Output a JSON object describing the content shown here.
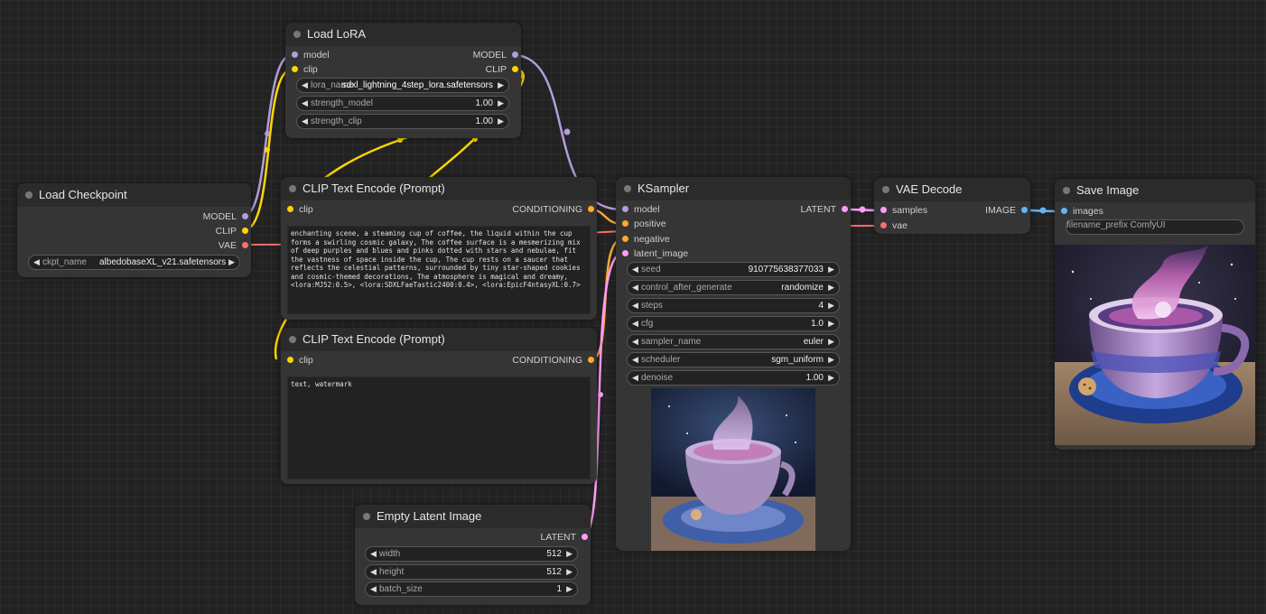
{
  "colors": {
    "model": "#b39ddb",
    "clip": "#ffd500",
    "vae": "#ff6e6e",
    "conditioning": "#ffa931",
    "latent": "#ff9cf9",
    "image": "#64b5f6"
  },
  "load_checkpoint": {
    "title": "Load Checkpoint",
    "out_model": "MODEL",
    "out_clip": "CLIP",
    "out_vae": "VAE",
    "ckpt_label": "ckpt_name",
    "ckpt_value": "albedobaseXL_v21.safetensors"
  },
  "load_lora": {
    "title": "Load LoRA",
    "in_model": "model",
    "in_clip": "clip",
    "out_model": "MODEL",
    "out_clip": "CLIP",
    "lora_label": "lora_name",
    "lora_value": "sdxl_lightning_4step_lora.safetensors",
    "strength_model_label": "strength_model",
    "strength_model_value": "1.00",
    "strength_clip_label": "strength_clip",
    "strength_clip_value": "1.00"
  },
  "clip_pos": {
    "title": "CLIP Text Encode (Prompt)",
    "in_clip": "clip",
    "out": "CONDITIONING",
    "text": "enchanting scene, a steaming cup of coffee, the liquid within the cup forms a swirling cosmic galaxy, The coffee surface is a mesmerizing mix of deep purples and blues and pinks dotted with stars and nebulae, fit the vastness of space inside the cup, The cup rests on a saucer that reflects the celestial patterns, surrounded by tiny star-shaped cookies and cosmic-themed decorations, The atmosphere is magical and dreamy, <lora:MJ52:0.5>, <lora:SDXLFaeTastic2400:0.4>, <lora:EpicF4ntasyXL:0.7>"
  },
  "clip_neg": {
    "title": "CLIP Text Encode (Prompt)",
    "in_clip": "clip",
    "out": "CONDITIONING",
    "text": "text, watermark"
  },
  "empty_latent": {
    "title": "Empty Latent Image",
    "out": "LATENT",
    "width_label": "width",
    "width_value": "512",
    "height_label": "height",
    "height_value": "512",
    "batch_label": "batch_size",
    "batch_value": "1"
  },
  "ksampler": {
    "title": "KSampler",
    "in_model": "model",
    "in_positive": "positive",
    "in_negative": "negative",
    "in_latent": "latent_image",
    "out": "LATENT",
    "seed_label": "seed",
    "seed_value": "910775638377033",
    "cag_label": "control_after_generate",
    "cag_value": "randomize",
    "steps_label": "steps",
    "steps_value": "4",
    "cfg_label": "cfg",
    "cfg_value": "1.0",
    "sampler_label": "sampler_name",
    "sampler_value": "euler",
    "scheduler_label": "scheduler",
    "scheduler_value": "sgm_uniform",
    "denoise_label": "denoise",
    "denoise_value": "1.00"
  },
  "vae_decode": {
    "title": "VAE Decode",
    "in_samples": "samples",
    "in_vae": "vae",
    "out": "IMAGE"
  },
  "save_image": {
    "title": "Save Image",
    "in_images": "images",
    "prefix_label": "filename_prefix",
    "prefix_value": "ComfyUI"
  }
}
